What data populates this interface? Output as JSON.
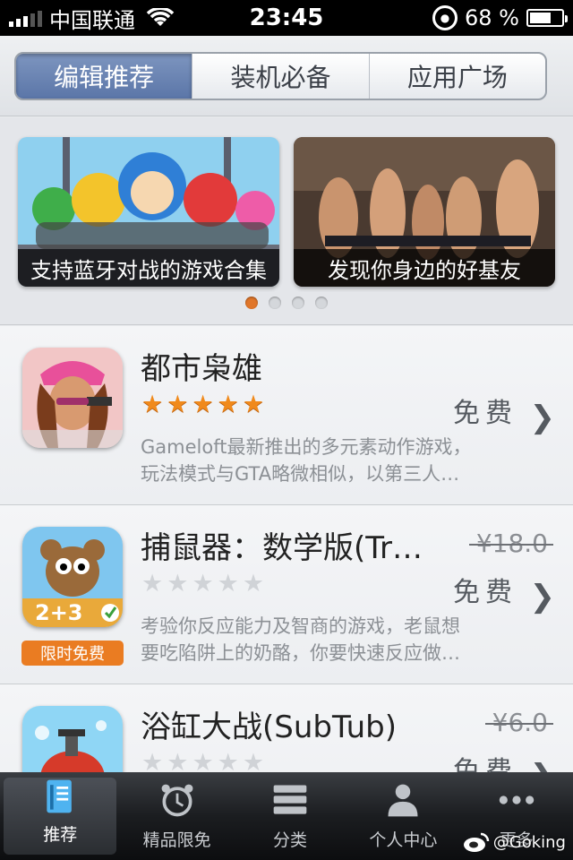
{
  "status_bar": {
    "carrier": "中国联通",
    "time": "23:45",
    "battery": "68 %",
    "battery_level": 0.68
  },
  "segments": [
    {
      "label": "编辑推荐",
      "active": true
    },
    {
      "label": "装机必备",
      "active": false
    },
    {
      "label": "应用广场",
      "active": false
    }
  ],
  "banners": [
    {
      "caption": "支持蓝牙对战的游戏合集"
    },
    {
      "caption": "发现你身边的好基友"
    }
  ],
  "page_indicator": {
    "count": 4,
    "active": 0
  },
  "apps": [
    {
      "name": "都市枭雄",
      "rating": 5,
      "price": "免费",
      "original_price": "",
      "description_line1": "Gameloft最新推出的多元素动作游戏，",
      "description_line2": "玩法模式与GTA略微相似，以第三人…",
      "badge": ""
    },
    {
      "name": "捕鼠器：数学版(Tr…",
      "rating": 0,
      "price": "免费",
      "original_price": "¥18.0",
      "description_line1": "考验你反应能力及智商的游戏，老鼠想",
      "description_line2": "要吃陷阱上的奶酪，你要快速反应做…",
      "badge": "限时免费"
    },
    {
      "name": "浴缸大战(SubTub)",
      "rating": 0,
      "price": "免费",
      "original_price": "¥6.0",
      "description_line1": "",
      "description_line2": "",
      "badge": ""
    }
  ],
  "tabs": [
    {
      "label": "推荐",
      "icon": "book-icon",
      "active": true
    },
    {
      "label": "精品限免",
      "icon": "alarm-clock-icon",
      "active": false
    },
    {
      "label": "分类",
      "icon": "stack-icon",
      "active": false
    },
    {
      "label": "个人中心",
      "icon": "person-icon",
      "active": false
    },
    {
      "label": "更多",
      "icon": "more-dots-icon",
      "active": false
    }
  ],
  "watermark": "@Goking",
  "colors": {
    "accent": "#e0762a",
    "segment_active": "#6a84b4",
    "star_on": "#f08a1c"
  }
}
